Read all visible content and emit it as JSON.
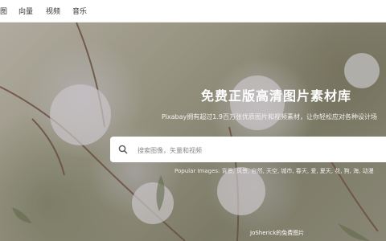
{
  "nav": {
    "items": [
      {
        "label": "图"
      },
      {
        "label": "向量"
      },
      {
        "label": "视频"
      },
      {
        "label": "音乐"
      }
    ]
  },
  "hero": {
    "title": "免费正版高清图片素材库",
    "subtitle": "Pixabay拥有超过1.9百万张优质图片和视频素材，让你轻松应对各种设计场",
    "search": {
      "placeholder": "搜索图像，矢量和视频",
      "icon": "search-icon"
    },
    "popular_images": "Popular Images: 背景, 风景, 自然, 天空, 城市, 春天, 爱, 夏天, 花, 狗, 海, 动漫",
    "credit": "JoSherick的免费图片"
  },
  "colors": {
    "accent_text": "#ffffff",
    "search_bg": "#ffffff"
  }
}
